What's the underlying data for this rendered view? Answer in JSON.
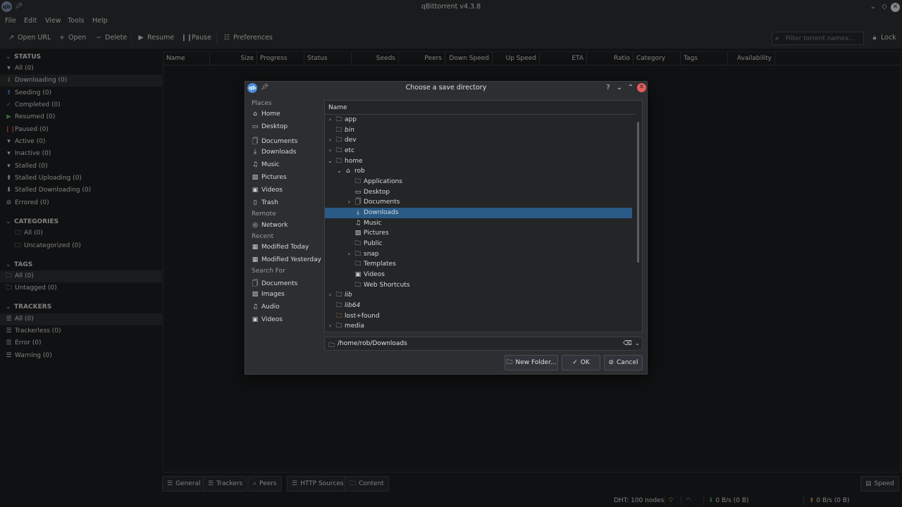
{
  "window": {
    "title": "qBittorrent v4.3.8",
    "logo": "qb"
  },
  "menu": [
    "File",
    "Edit",
    "View",
    "Tools",
    "Help"
  ],
  "toolbar": {
    "open_url": "Open URL",
    "open": "Open",
    "delete": "Delete",
    "resume": "Resume",
    "pause": "Pause",
    "preferences": "Preferences",
    "filter_placeholder": "Filter torrent names...",
    "lock": "Lock"
  },
  "sidebar": {
    "status_title": "STATUS",
    "status": [
      "All (0)",
      "Downloading (0)",
      "Seeding (0)",
      "Completed (0)",
      "Resumed (0)",
      "Paused (0)",
      "Active (0)",
      "Inactive (0)",
      "Stalled (0)",
      "Stalled Uploading (0)",
      "Stalled Downloading (0)",
      "Errored (0)"
    ],
    "categories_title": "CATEGORIES",
    "categories": [
      "All (0)",
      "Uncategorized (0)"
    ],
    "tags_title": "TAGS",
    "tags": [
      "All (0)",
      "Untagged (0)"
    ],
    "trackers_title": "TRACKERS",
    "trackers": [
      "All (0)",
      "Trackerless (0)",
      "Error (0)",
      "Warning (0)"
    ]
  },
  "columns": [
    "Name",
    "Size",
    "Progress",
    "Status",
    "Seeds",
    "Peers",
    "Down Speed",
    "Up Speed",
    "ETA",
    "Ratio",
    "Category",
    "Tags",
    "Availability"
  ],
  "bottom_tabs": [
    "General",
    "Trackers",
    "Peers",
    "HTTP Sources",
    "Content"
  ],
  "statusbar": {
    "dht": "DHT: 100 nodes",
    "down": "0 B/s (0 B)",
    "up": "0 B/s (0 B)",
    "speed": "Speed"
  },
  "dialog": {
    "title": "Choose a save directory",
    "logo": "qb",
    "places_title": "Places",
    "places": [
      "Home",
      "Desktop",
      "Documents",
      "Downloads",
      "Music",
      "Pictures",
      "Videos",
      "Trash"
    ],
    "remote_title": "Remote",
    "remote": [
      "Network"
    ],
    "recent_title": "Recent",
    "recent": [
      "Modified Today",
      "Modified Yesterday"
    ],
    "search_title": "Search For",
    "search": [
      "Documents",
      "Images",
      "Audio",
      "Videos"
    ],
    "tree_header": "Name",
    "tree": [
      "app",
      "bin",
      "dev",
      "etc",
      "home",
      "rob",
      "Applications",
      "Desktop",
      "Documents",
      "Downloads",
      "Music",
      "Pictures",
      "Public",
      "snap",
      "Templates",
      "Videos",
      "Web Shortcuts",
      "lib",
      "lib64",
      "lost+found",
      "media"
    ],
    "selected": "Downloads",
    "path": "/home/rob/Downloads",
    "new_folder": "New Folder...",
    "ok": "OK",
    "cancel": "Cancel"
  }
}
